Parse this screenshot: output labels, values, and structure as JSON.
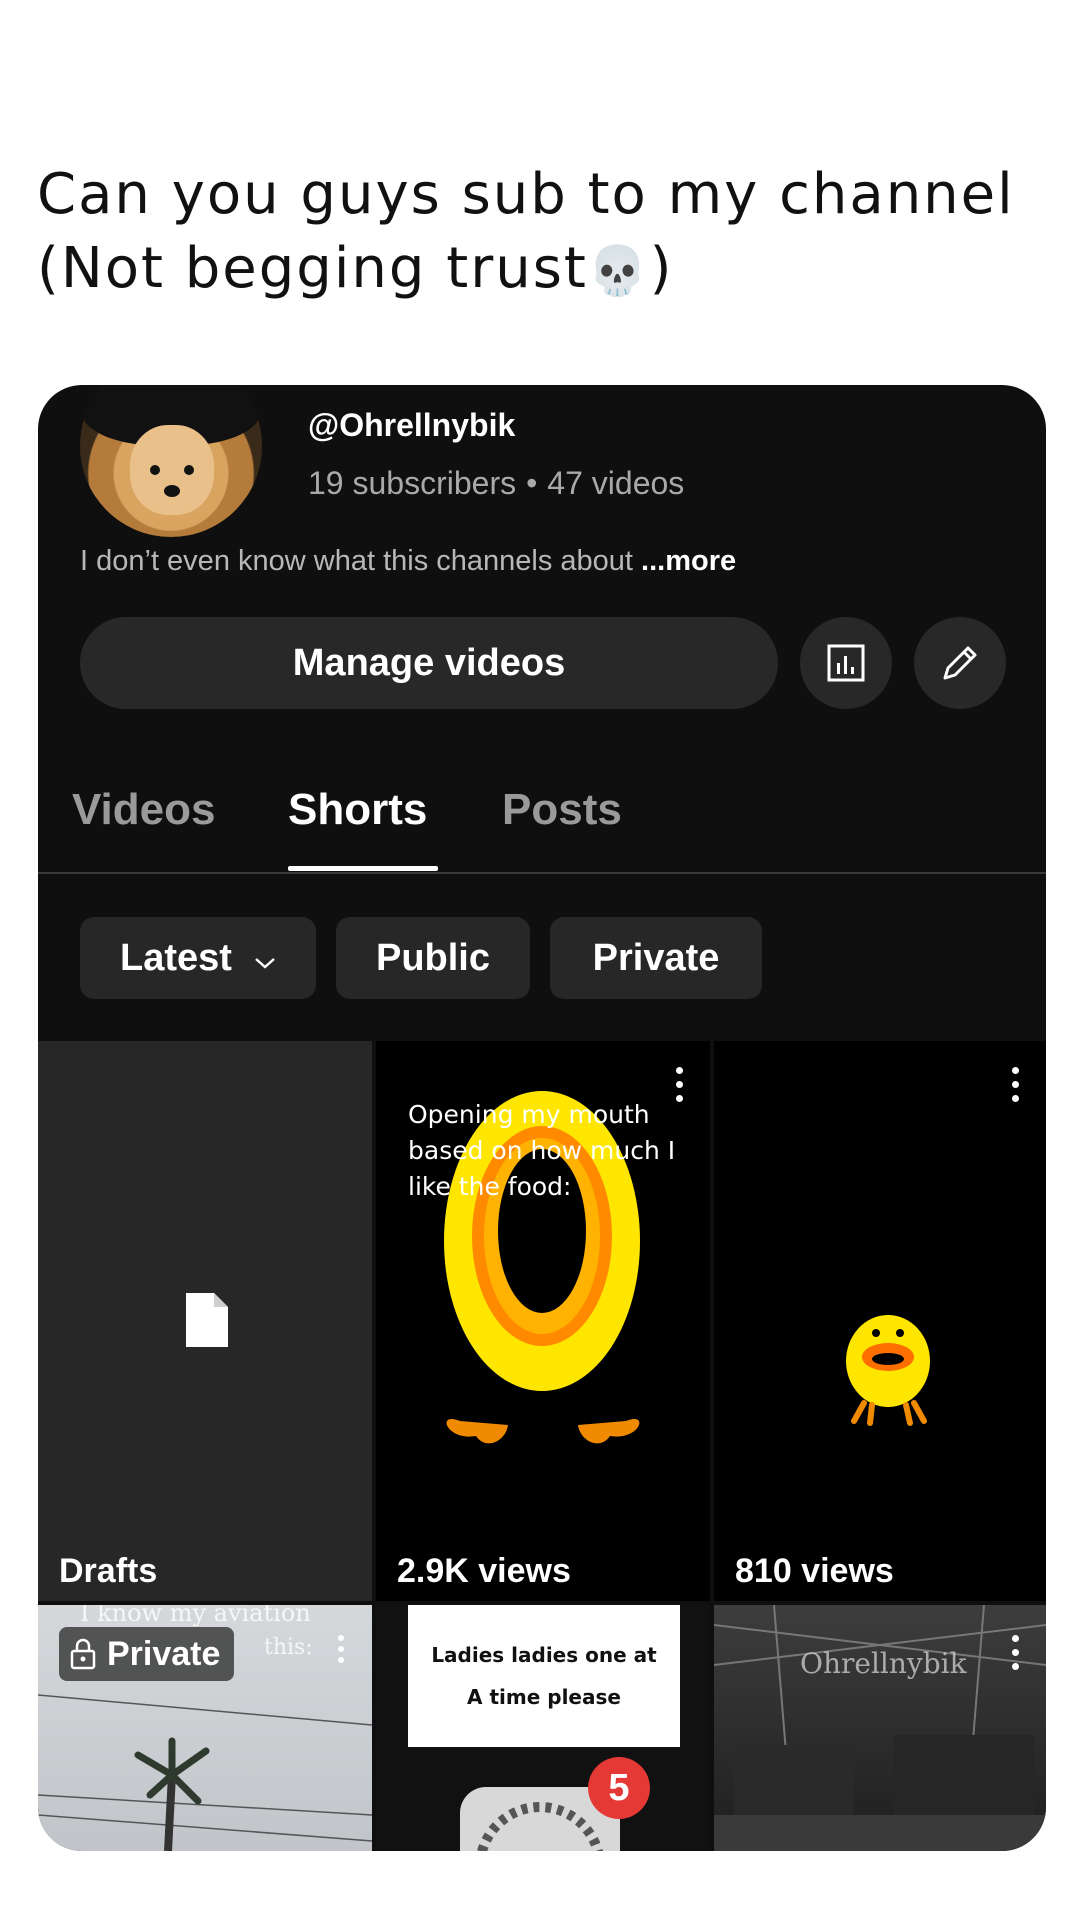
{
  "caption": {
    "line1": "Can you guys sub to my channel",
    "line2": "(Not begging trust",
    "emoji": "💀",
    "line2_end": ")"
  },
  "channel": {
    "handle": "@Ohrellnybik",
    "subscribers": "19 subscribers",
    "separator": "•",
    "videos": "47 videos",
    "description": "I don’t even know what this channels about",
    "more_label": "...more"
  },
  "actions": {
    "manage_label": "Manage videos",
    "stats_icon": "analytics-icon",
    "edit_icon": "pencil-icon"
  },
  "tabs": [
    {
      "label": "Videos",
      "active": false
    },
    {
      "label": "Shorts",
      "active": true
    },
    {
      "label": "Posts",
      "active": false
    }
  ],
  "filters": {
    "sort": "Latest",
    "public": "Public",
    "private": "Private"
  },
  "grid": {
    "drafts_label": "Drafts",
    "video1": {
      "text": "Opening my mouth based on how much I like the food:",
      "views": "2.9K views"
    },
    "video2": {
      "views": "810 views"
    },
    "video3": {
      "overlay_text": "I know my aviation",
      "overlay_text2": "this:",
      "badge": "Private"
    },
    "video4": {
      "line1": "Ladies ladies one at",
      "line2": "A time please",
      "notification_count": "5"
    },
    "video5": {
      "watermark": "Ohrellnybik"
    }
  },
  "colors": {
    "card_bg": "#0f0f0f",
    "chip_bg": "#272727",
    "notification_red": "#e53935",
    "duck_yellow": "#ffd600",
    "duck_orange": "#f57c00"
  }
}
